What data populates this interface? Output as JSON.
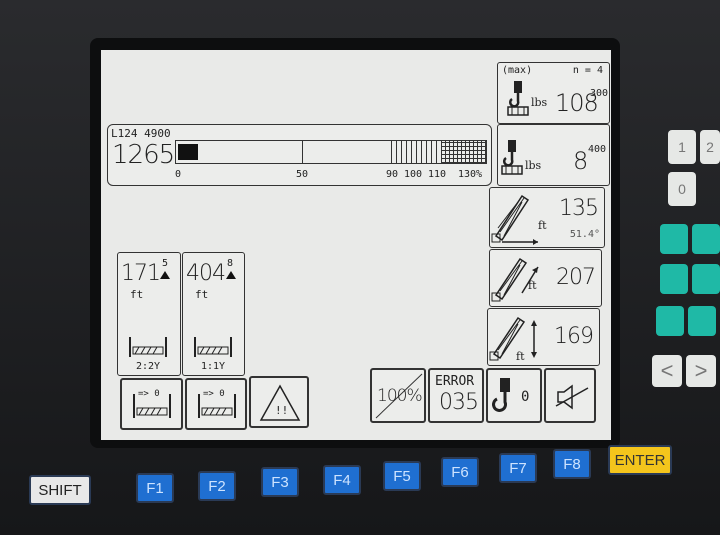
{
  "load_moment": {
    "config_code": "L124 4900",
    "value": "1265",
    "scale": [
      "0",
      "50",
      "90",
      "100",
      "110",
      "130%"
    ],
    "fill_percent": 0
  },
  "max_load": {
    "tag": "(max)",
    "parts_line": "n = 4",
    "unit": "lbs",
    "value": "108",
    "value_sup": "300"
  },
  "actual_load": {
    "unit": "lbs",
    "value": "8",
    "value_sup": "400"
  },
  "radius": {
    "unit": "ft",
    "value": "135",
    "angle": "51.4°"
  },
  "boom_length": {
    "unit": "ft",
    "value": "207"
  },
  "hook_height": {
    "unit": "ft",
    "value": "169"
  },
  "left_panels": [
    {
      "value": "171",
      "sup": "5",
      "unit": "ft",
      "ratio": "2:2Y"
    },
    {
      "value": "404",
      "sup": "8",
      "unit": "ft",
      "ratio": "1:1Y"
    }
  ],
  "bottom_left": [
    {
      "label": "=> 0"
    },
    {
      "label": "=> 0"
    }
  ],
  "bottom_right": {
    "percent": "100%",
    "error_label": "ERROR",
    "error_code": "035",
    "hook_count": "0"
  },
  "fkeys": [
    "SHIFT",
    "F1",
    "F2",
    "F3",
    "F4",
    "F5",
    "F6",
    "F7",
    "F8",
    "ENTER"
  ],
  "keypad_numbers": [
    "1",
    "2",
    "0"
  ],
  "keypad_arrows": [
    "<",
    ">"
  ]
}
